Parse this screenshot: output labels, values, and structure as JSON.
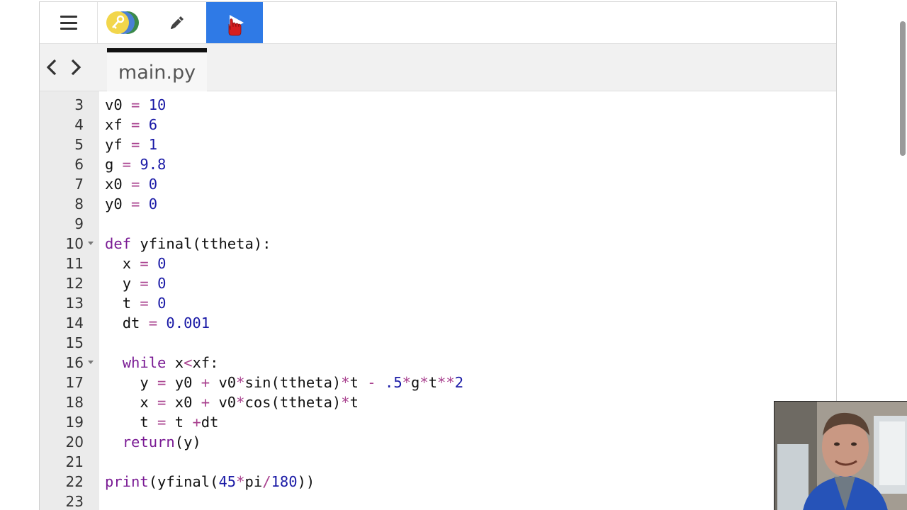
{
  "toolbar": {
    "menu_icon": "hamburger-menu-icon",
    "library_icon": "library-key-icon",
    "edit_icon": "pencil-icon",
    "run_icon": "play-icon",
    "run_color": "#2f7ae6"
  },
  "tabs": [
    {
      "label": "main.py",
      "active": true
    }
  ],
  "editor": {
    "lines": [
      {
        "n": "3",
        "fold": false,
        "indent": 0,
        "tokens": [
          [
            "v0",
            ""
          ],
          [
            " = ",
            "op"
          ],
          [
            "10",
            "num"
          ]
        ]
      },
      {
        "n": "4",
        "fold": false,
        "indent": 0,
        "tokens": [
          [
            "xf",
            ""
          ],
          [
            " = ",
            "op"
          ],
          [
            "6",
            "num"
          ]
        ]
      },
      {
        "n": "5",
        "fold": false,
        "indent": 0,
        "tokens": [
          [
            "yf",
            ""
          ],
          [
            " = ",
            "op"
          ],
          [
            "1",
            "num"
          ]
        ]
      },
      {
        "n": "6",
        "fold": false,
        "indent": 0,
        "tokens": [
          [
            "g",
            ""
          ],
          [
            " = ",
            "op"
          ],
          [
            "9.8",
            "num"
          ]
        ]
      },
      {
        "n": "7",
        "fold": false,
        "indent": 0,
        "tokens": [
          [
            "x0",
            ""
          ],
          [
            " = ",
            "op"
          ],
          [
            "0",
            "num"
          ]
        ]
      },
      {
        "n": "8",
        "fold": false,
        "indent": 0,
        "tokens": [
          [
            "y0",
            ""
          ],
          [
            " = ",
            "op"
          ],
          [
            "0",
            "num"
          ]
        ]
      },
      {
        "n": "9",
        "fold": false,
        "indent": 0,
        "tokens": []
      },
      {
        "n": "10",
        "fold": true,
        "indent": 0,
        "tokens": [
          [
            "def",
            "kw"
          ],
          [
            " yfinal(ttheta):",
            ""
          ]
        ]
      },
      {
        "n": "11",
        "fold": false,
        "indent": 1,
        "tokens": [
          [
            "x",
            ""
          ],
          [
            " = ",
            "op"
          ],
          [
            "0",
            "num"
          ]
        ]
      },
      {
        "n": "12",
        "fold": false,
        "indent": 1,
        "tokens": [
          [
            "y",
            ""
          ],
          [
            " = ",
            "op"
          ],
          [
            "0",
            "num"
          ]
        ]
      },
      {
        "n": "13",
        "fold": false,
        "indent": 1,
        "tokens": [
          [
            "t",
            ""
          ],
          [
            " = ",
            "op"
          ],
          [
            "0",
            "num"
          ]
        ]
      },
      {
        "n": "14",
        "fold": false,
        "indent": 1,
        "tokens": [
          [
            "dt",
            ""
          ],
          [
            " = ",
            "op"
          ],
          [
            "0.001",
            "num"
          ]
        ]
      },
      {
        "n": "15",
        "fold": false,
        "indent": 0,
        "tokens": []
      },
      {
        "n": "16",
        "fold": true,
        "indent": 1,
        "tokens": [
          [
            "while",
            "kw"
          ],
          [
            " x",
            ""
          ],
          [
            "<",
            "op"
          ],
          [
            "xf:",
            ""
          ]
        ]
      },
      {
        "n": "17",
        "fold": false,
        "indent": 2,
        "tokens": [
          [
            "y",
            ""
          ],
          [
            " = ",
            "op"
          ],
          [
            "y0",
            ""
          ],
          [
            " + ",
            "op"
          ],
          [
            "v0",
            ""
          ],
          [
            "*",
            "op"
          ],
          [
            "sin(ttheta)",
            ""
          ],
          [
            "*",
            "op"
          ],
          [
            "t",
            ""
          ],
          [
            " - ",
            "op"
          ],
          [
            ".5",
            "num"
          ],
          [
            "*",
            "op"
          ],
          [
            "g",
            ""
          ],
          [
            "*",
            "op"
          ],
          [
            "t",
            ""
          ],
          [
            "**",
            "op"
          ],
          [
            "2",
            "num"
          ]
        ]
      },
      {
        "n": "18",
        "fold": false,
        "indent": 2,
        "tokens": [
          [
            "x",
            ""
          ],
          [
            " = ",
            "op"
          ],
          [
            "x0",
            ""
          ],
          [
            " + ",
            "op"
          ],
          [
            "v0",
            ""
          ],
          [
            "*",
            "op"
          ],
          [
            "cos(ttheta)",
            ""
          ],
          [
            "*",
            "op"
          ],
          [
            "t",
            ""
          ]
        ]
      },
      {
        "n": "19",
        "fold": false,
        "indent": 2,
        "tokens": [
          [
            "t",
            ""
          ],
          [
            " = ",
            "op"
          ],
          [
            "t ",
            ""
          ],
          [
            "+",
            "op"
          ],
          [
            "dt",
            ""
          ]
        ]
      },
      {
        "n": "20",
        "fold": false,
        "indent": 1,
        "tokens": [
          [
            "return",
            "kw"
          ],
          [
            "(y)",
            ""
          ]
        ]
      },
      {
        "n": "21",
        "fold": false,
        "indent": 0,
        "tokens": []
      },
      {
        "n": "22",
        "fold": false,
        "indent": 0,
        "tokens": [
          [
            "print",
            "kw"
          ],
          [
            "(yfinal(",
            ""
          ],
          [
            "45",
            "num"
          ],
          [
            "*",
            "op"
          ],
          [
            "pi",
            ""
          ],
          [
            "/",
            "op"
          ],
          [
            "180",
            "num"
          ],
          [
            "))",
            ""
          ]
        ]
      },
      {
        "n": "23",
        "fold": false,
        "indent": 0,
        "tokens": []
      }
    ]
  },
  "webcam": {
    "icon": "webcam-presenter-icon"
  }
}
